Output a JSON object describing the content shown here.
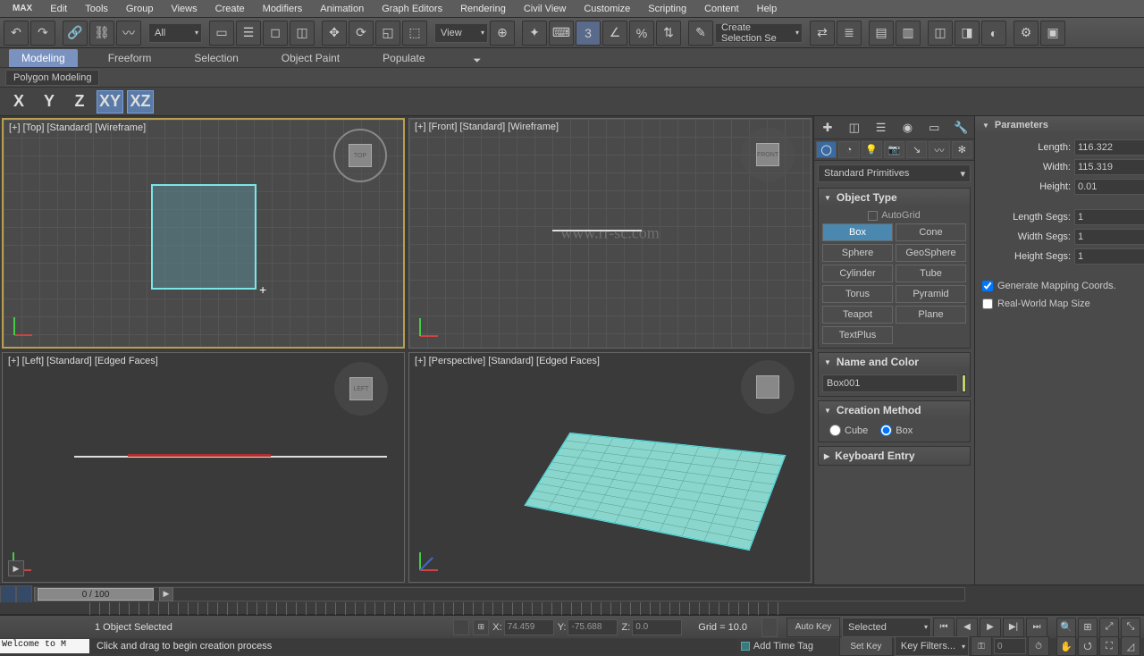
{
  "menu": {
    "logo": "MAX",
    "items": [
      "Edit",
      "Tools",
      "Group",
      "Views",
      "Create",
      "Modifiers",
      "Animation",
      "Graph Editors",
      "Rendering",
      "Civil View",
      "Customize",
      "Scripting",
      "Content",
      "Help"
    ]
  },
  "toolbar": {
    "filter_combo": "All",
    "view_combo": "View",
    "selection_set": "Create Selection Se"
  },
  "ribbon": {
    "tabs": [
      "Modeling",
      "Freeform",
      "Selection",
      "Object Paint",
      "Populate"
    ],
    "active": 0,
    "sub_label": "Polygon Modeling"
  },
  "axes": {
    "labels": [
      "X",
      "Y",
      "Z",
      "XY",
      "XZ"
    ],
    "active": [
      3
    ]
  },
  "viewports": {
    "top": {
      "label": "[+] [Top] [Standard] [Wireframe]",
      "cube": "TOP"
    },
    "front": {
      "label": "[+] [Front] [Standard] [Wireframe]",
      "cube": "FRONT"
    },
    "left": {
      "label": "[+] [Left] [Standard] [Edged Faces]",
      "cube": "LEFT"
    },
    "persp": {
      "label": "[+] [Perspective] [Standard] [Edged Faces]",
      "cube": ""
    },
    "watermark": "www.rr-sc.com"
  },
  "command_panel": {
    "category_combo": "Standard Primitives",
    "rollout_object_type": "Object Type",
    "autogrid": "AutoGrid",
    "types": [
      "Box",
      "Cone",
      "Sphere",
      "GeoSphere",
      "Cylinder",
      "Tube",
      "Torus",
      "Pyramid",
      "Teapot",
      "Plane",
      "TextPlus"
    ],
    "type_active": 0,
    "rollout_name": "Name and Color",
    "object_name": "Box001",
    "object_color": "#c0d070",
    "rollout_method": "Creation Method",
    "method_options": [
      "Cube",
      "Box"
    ],
    "method_selected": 1,
    "rollout_kbd": "Keyboard Entry"
  },
  "parameters": {
    "title": "Parameters",
    "length_lbl": "Length:",
    "length_val": "116.322",
    "width_lbl": "Width:",
    "width_val": "115.319",
    "height_lbl": "Height:",
    "height_val": "0.01",
    "lsegs_lbl": "Length Segs:",
    "lsegs_val": "1",
    "wsegs_lbl": "Width Segs:",
    "wsegs_val": "1",
    "hsegs_lbl": "Height Segs:",
    "hsegs_val": "1",
    "gen_map": "Generate Mapping Coords.",
    "gen_map_checked": true,
    "real_world": "Real-World Map Size",
    "real_world_checked": false
  },
  "timeline": {
    "slider_label": "0 / 100"
  },
  "status": {
    "script_label": "",
    "selected": "1 Object Selected",
    "x_lbl": "X:",
    "x_val": "74.459",
    "y_lbl": "Y:",
    "y_val": "-75.688",
    "z_lbl": "Z:",
    "z_val": "0.0",
    "grid": "Grid = 10.0",
    "autokey": "Auto Key",
    "setkey": "Set Key",
    "selected_combo": "Selected",
    "keyfilters": "Key Filters...",
    "add_tag": "Add Time Tag"
  },
  "prompt": {
    "maxscript": "Welcome to M",
    "message": "Click and drag to begin creation process"
  }
}
